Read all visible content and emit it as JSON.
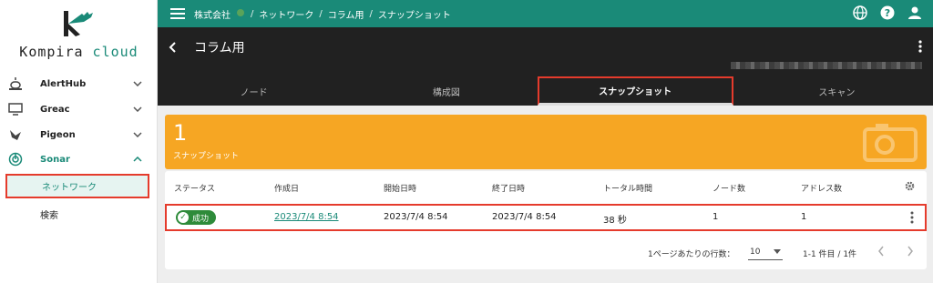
{
  "brand": {
    "word1": "Kompira",
    "word2": "cloud"
  },
  "sidebar": {
    "items": [
      {
        "label": "AlertHub",
        "icon": "siren-icon"
      },
      {
        "label": "Greac",
        "icon": "monitor-icon"
      },
      {
        "label": "Pigeon",
        "icon": "pigeon-icon"
      },
      {
        "label": "Sonar",
        "icon": "sonar-icon"
      }
    ],
    "sub_items": [
      {
        "label": "ネットワーク"
      },
      {
        "label": "検索"
      }
    ]
  },
  "topbar": {
    "crumbs": [
      "株式会社",
      "ネットワーク",
      "コラム用",
      "スナップショット"
    ],
    "separator": "/"
  },
  "header": {
    "title": "コラム用",
    "tabs": [
      "ノード",
      "構成図",
      "スナップショット",
      "スキャン"
    ]
  },
  "stat": {
    "value": "1",
    "caption": "スナップショット"
  },
  "table": {
    "columns": [
      "ステータス",
      "作成日",
      "開始日時",
      "終了日時",
      "トータル時間",
      "ノード数",
      "アドレス数"
    ],
    "rows": [
      {
        "status": "成功",
        "created": "2023/7/4 8:54",
        "start": "2023/7/4 8:54",
        "end": "2023/7/4 8:54",
        "total": "38 秒",
        "nodes": "1",
        "addresses": "1"
      }
    ],
    "footer": {
      "rows_per_page_label": "1ページあたりの行数：",
      "rows_per_page": "10",
      "range": "1-1 件目 / 1件"
    }
  },
  "colors": {
    "primary": "#1a8a78",
    "accent": "#f6a623",
    "highlight": "#e53b2c",
    "success": "#2e8b3a"
  }
}
